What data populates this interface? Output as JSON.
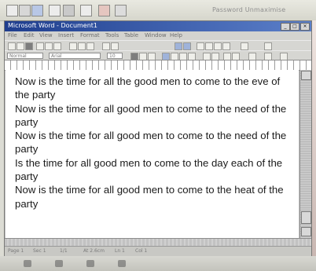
{
  "top_strip": {
    "right_text": "Password  Unmaximise"
  },
  "window": {
    "title": "Microsoft Word - Document1",
    "min_glyph": "_",
    "max_glyph": "□",
    "close_glyph": "×"
  },
  "menubar": {
    "items": [
      "File",
      "Edit",
      "View",
      "Insert",
      "Format",
      "Tools",
      "Table",
      "Window",
      "Help"
    ]
  },
  "formatting": {
    "style": "Normal",
    "font": "Arial",
    "size": "10"
  },
  "document": {
    "paragraphs": [
      "Now is the time for all the good men to come to the eve of the party",
      "Now is the time for all good men to come to the need of the party",
      "Now is the time for all good men to come to the need of the party",
      "Is the time for all good men to come to the day each of the party",
      "Now is the time for all good men to come to the heat of the party"
    ]
  },
  "statusbar": {
    "page": "Page 1",
    "sec": "Sec 1",
    "pos": "1/1",
    "at": "At 2.6cm",
    "ln": "Ln 1",
    "col": "Col 1"
  },
  "colors": {
    "title_bar": "#1f3e8e",
    "document_bg": "#ffffff",
    "chrome": "#c0c0c0"
  }
}
